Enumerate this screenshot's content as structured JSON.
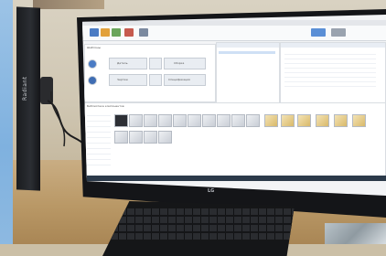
{
  "scene": {
    "side_monitor_brand": "Radiant",
    "main_monitor_logo": "LG",
    "app": {
      "panels_title": "Шаблоны",
      "tile_labels": [
        "Деталь",
        "Сборка",
        "Чертеж",
        "Спецификация"
      ],
      "right_tabs": [
        "Проект",
        "Свойства",
        "Справочник"
      ],
      "library_title": "Библиотека компонентов"
    }
  }
}
